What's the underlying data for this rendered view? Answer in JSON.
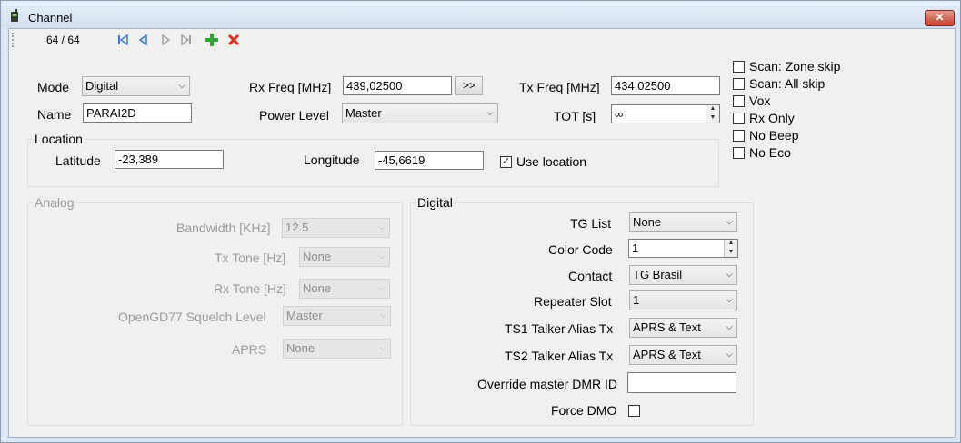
{
  "window": {
    "title": "Channel",
    "close_label": "✕"
  },
  "toolbar": {
    "counter": "64 / 64",
    "icons": [
      "first-icon",
      "prev-icon",
      "next-icon",
      "last-icon",
      "add-icon",
      "delete-icon"
    ]
  },
  "main": {
    "mode_label": "Mode",
    "mode_value": "Digital",
    "name_label": "Name",
    "name_value": "PARAI2D",
    "rx_label": "Rx Freq [MHz]",
    "rx_value": "439,02500",
    "copy_button": ">>",
    "tx_label": "Tx Freq [MHz]",
    "tx_value": "434,02500",
    "power_label": "Power Level",
    "power_value": "Master",
    "tot_label": "TOT [s]",
    "tot_value": "∞"
  },
  "options": [
    {
      "label": "Scan: Zone skip",
      "checked": false
    },
    {
      "label": "Scan: All skip",
      "checked": false
    },
    {
      "label": "Vox",
      "checked": false
    },
    {
      "label": "Rx Only",
      "checked": false
    },
    {
      "label": "No Beep",
      "checked": false
    },
    {
      "label": "No Eco",
      "checked": false
    }
  ],
  "location": {
    "group_label": "Location",
    "lat_label": "Latitude",
    "lat_value": "-23,389",
    "lon_label": "Longitude",
    "lon_value": "-45,6619",
    "use_label": "Use location",
    "use_checked": true
  },
  "analog": {
    "group_label": "Analog",
    "bandwidth_label": "Bandwidth [KHz]",
    "bandwidth_value": "12.5",
    "txtone_label": "Tx Tone [Hz]",
    "txtone_value": "None",
    "rxtone_label": "Rx Tone [Hz]",
    "rxtone_value": "None",
    "squelch_label": "OpenGD77 Squelch Level",
    "squelch_value": "Master",
    "aprs_label": "APRS",
    "aprs_value": "None"
  },
  "digital": {
    "group_label": "Digital",
    "tglist_label": "TG List",
    "tglist_value": "None",
    "color_label": "Color Code",
    "color_value": "1",
    "contact_label": "Contact",
    "contact_value": "TG Brasil",
    "slot_label": "Repeater Slot",
    "slot_value": "1",
    "ts1_label": "TS1 Talker Alias Tx",
    "ts1_value": "APRS & Text",
    "ts2_label": "TS2 Talker Alias Tx",
    "ts2_value": "APRS & Text",
    "override_label": "Override master DMR ID",
    "override_value": "",
    "forcedmo_label": "Force DMO",
    "forcedmo_checked": false
  }
}
